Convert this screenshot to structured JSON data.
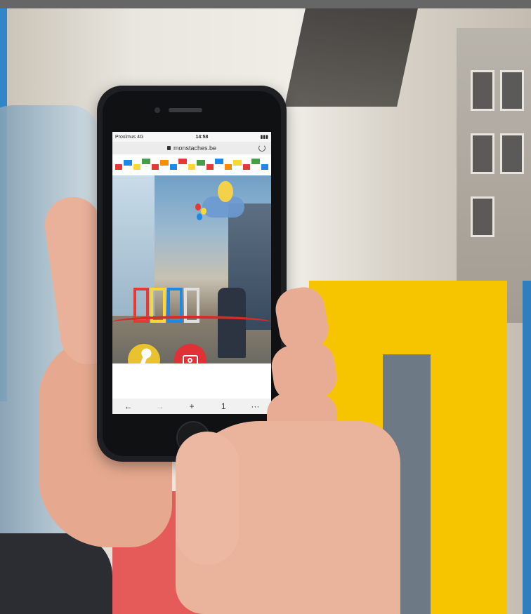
{
  "status_bar": {
    "carrier": "Proximus 4G",
    "time": "14:58"
  },
  "browser": {
    "url": "monstaches.be"
  },
  "toolbar": {
    "back": "←",
    "forward": "→",
    "new_tab": "+",
    "tabs": "1",
    "more": "···"
  },
  "colors": {
    "frame_yellow": "#f6c500",
    "camera_button": "#e03136",
    "key_button": "#e8c230"
  }
}
